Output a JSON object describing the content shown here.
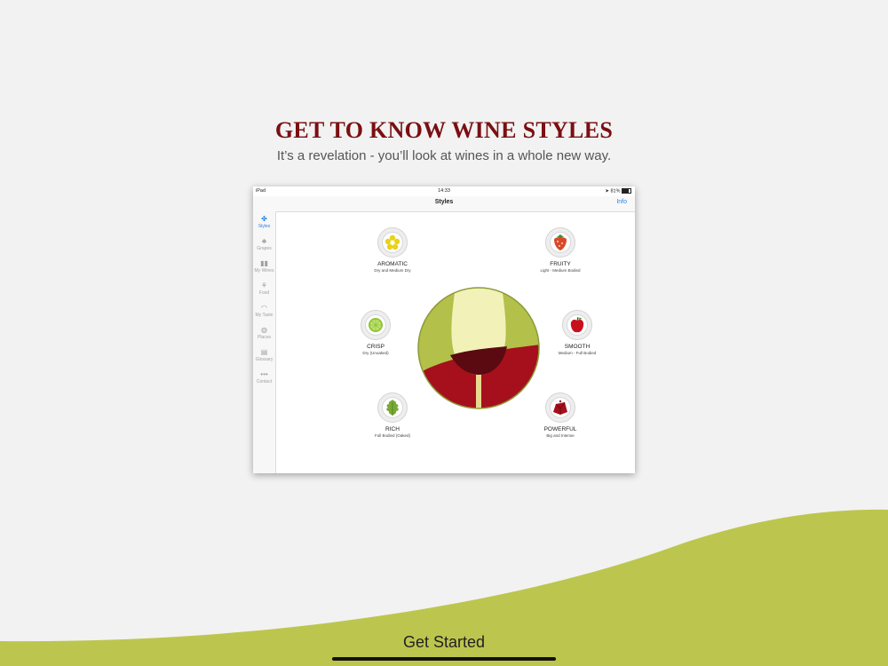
{
  "colors": {
    "accent_title": "#7a0f12",
    "wave_green": "#bcc64e",
    "ios_blue": "#2a85e6",
    "wine_red": "#a5101c",
    "glass_green": "#b3c04a"
  },
  "hero": {
    "title": "GET TO KNOW WINE STYLES",
    "subtitle": "It’s a revelation - you’ll look at wines in a whole new way."
  },
  "device": {
    "status": {
      "device_label": "iPad",
      "time": "14:33",
      "battery": "81%"
    },
    "nav": {
      "title": "Styles",
      "info_label": "Info"
    },
    "sidebar": [
      {
        "label": "Styles",
        "icon": "styles-icon",
        "glyph": "✤",
        "active": true
      },
      {
        "label": "Grapes",
        "icon": "grapes-icon",
        "glyph": "♣",
        "active": false
      },
      {
        "label": "My Wines",
        "icon": "bottles-icon",
        "glyph": "▮▮",
        "active": false
      },
      {
        "label": "Food",
        "icon": "food-icon",
        "glyph": "⚘",
        "active": false
      },
      {
        "label": "My Taste",
        "icon": "lips-icon",
        "glyph": "◠",
        "active": false
      },
      {
        "label": "Places",
        "icon": "globe-icon",
        "glyph": "◍",
        "active": false
      },
      {
        "label": "Glossary",
        "icon": "book-icon",
        "glyph": "▤",
        "active": false
      },
      {
        "label": "Contact",
        "icon": "more-icon",
        "glyph": "•••",
        "active": false
      }
    ],
    "styles": [
      {
        "name": "AROMATIC",
        "desc": "Dry and Medium Dry",
        "icon": "flower-icon"
      },
      {
        "name": "FRUITY",
        "desc": "Light - Medium Bodied",
        "icon": "strawberry-icon"
      },
      {
        "name": "CRISP",
        "desc": "Dry (Unoaked)",
        "icon": "lime-icon"
      },
      {
        "name": "SMOOTH",
        "desc": "Medium - Full Bodied",
        "icon": "apple-icon"
      },
      {
        "name": "RICH",
        "desc": "Full Bodied (Oaked)",
        "icon": "oak-leaf-icon"
      },
      {
        "name": "POWERFUL",
        "desc": "Big and Intense",
        "icon": "gem-icon"
      }
    ]
  },
  "cta": {
    "label": "Get Started"
  }
}
